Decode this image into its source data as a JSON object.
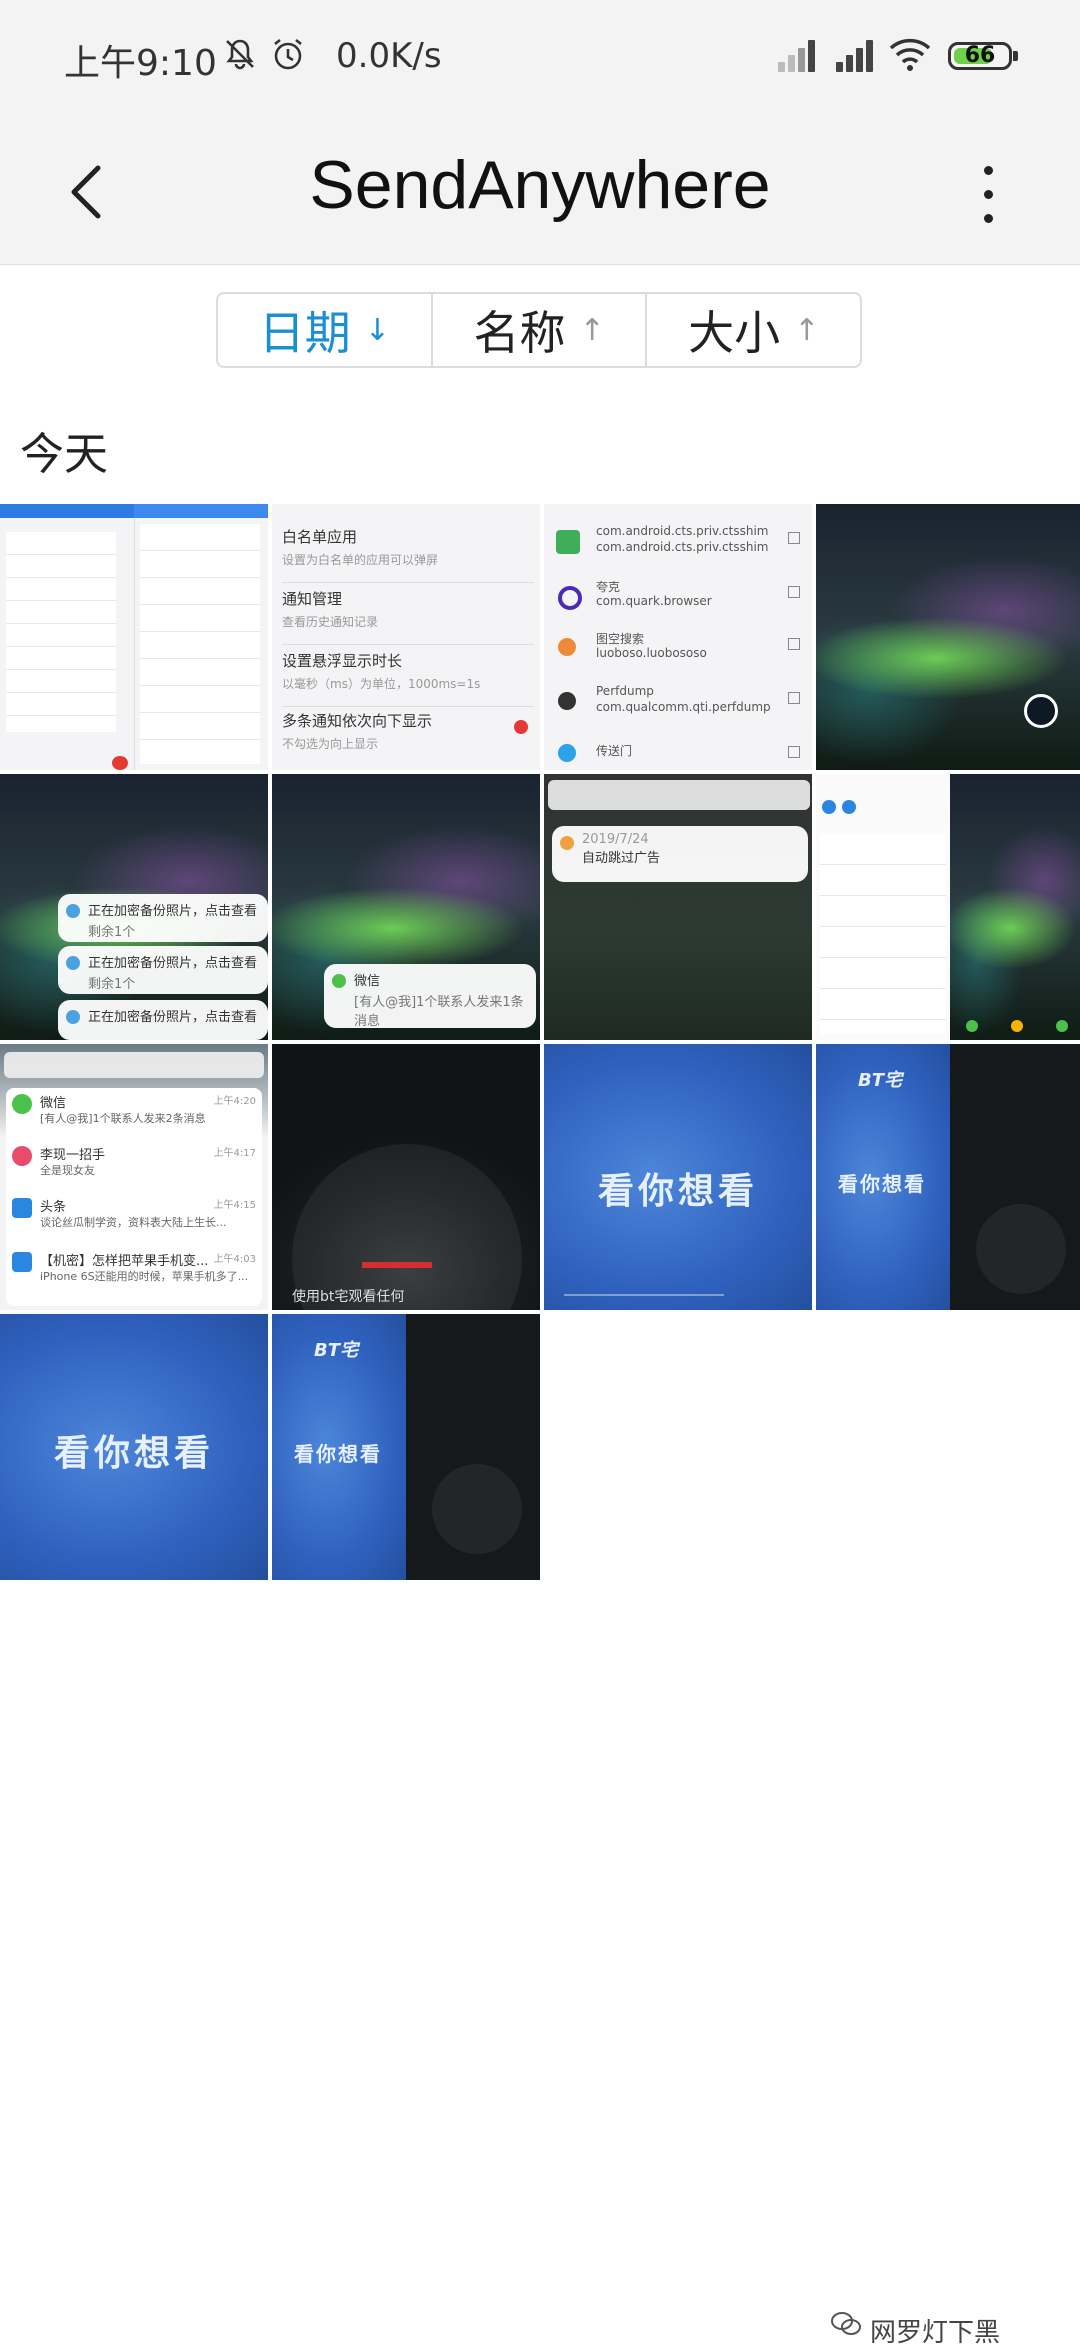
{
  "status_bar": {
    "time": "上午9:10",
    "speed": "0.0K/s",
    "battery": "66"
  },
  "header": {
    "title": "SendAnywhere"
  },
  "sort": {
    "options": [
      {
        "label": "日期",
        "arrow": "↓",
        "active": true
      },
      {
        "label": "名称",
        "arrow": "↑",
        "active": false
      },
      {
        "label": "大小",
        "arrow": "↑",
        "active": false
      }
    ]
  },
  "section": {
    "title": "今天"
  },
  "thumbs": {
    "t2": {
      "items": [
        {
          "title": "白名单应用",
          "sub": "设置为白名单的应用可以弹屏"
        },
        {
          "title": "通知管理",
          "sub": "查看历史通知记录"
        },
        {
          "title": "设置悬浮显示时长",
          "sub": "以毫秒（ms）为单位，1000ms=1s"
        },
        {
          "title": "多条通知依次向下显示",
          "sub": "不勾选为向上显示"
        }
      ]
    },
    "t3": {
      "items": [
        {
          "name": "com.android.cts.priv.ctsshim",
          "pkg": "com.android.cts.priv.ctsshim"
        },
        {
          "name": "夸克",
          "pkg": "com.quark.browser"
        },
        {
          "name": "图空搜索",
          "pkg": "luoboso.luobososo"
        },
        {
          "name": "Perfdump",
          "pkg": "com.qualcomm.qti.perfdump"
        },
        {
          "name": "传送门",
          "pkg": ""
        }
      ]
    },
    "t5": {
      "items": [
        {
          "text": "正在加密备份照片，点击查看",
          "sub": "剩余1个"
        },
        {
          "text": "正在加密备份照片，点击查看",
          "sub": "剩余1个"
        },
        {
          "text": "正在加密备份照片，点击查看",
          "sub": ""
        }
      ]
    },
    "t6": {
      "title": "微信",
      "text": "[有人@我]1个联系人发来1条消息"
    },
    "t7": {
      "date": "2019/7/24",
      "text": "自动跳过广告"
    },
    "t9": {
      "items": [
        {
          "title": "微信",
          "text": "[有人@我]1个联系人发来2条消息",
          "time": "上午4:20"
        },
        {
          "title": "李现一招手",
          "text": "全是现女友",
          "time": "上午4:17"
        },
        {
          "title": "头条",
          "text": "谈论丝瓜制学资，资料表大陆上生长...",
          "time": "上午4:15"
        },
        {
          "title": "【机密】怎样把苹果手机变...",
          "text": "iPhone 6S还能用的时候，苹果手机多了...",
          "time": "上午4:03"
        }
      ]
    },
    "t10": {
      "text": "使用bt宅观看任何"
    },
    "t11": {
      "text": "看你想看"
    },
    "t12": {
      "logo": "BT宅",
      "text": "看你想看"
    },
    "t13": {
      "text": "看你想看"
    },
    "t14": {
      "logo": "BT宅",
      "text": "看你想看"
    }
  },
  "watermark": "网罗灯下黑",
  "colors": {
    "accent": "#1b8fd4",
    "header_bg": "#f3f3f3"
  }
}
